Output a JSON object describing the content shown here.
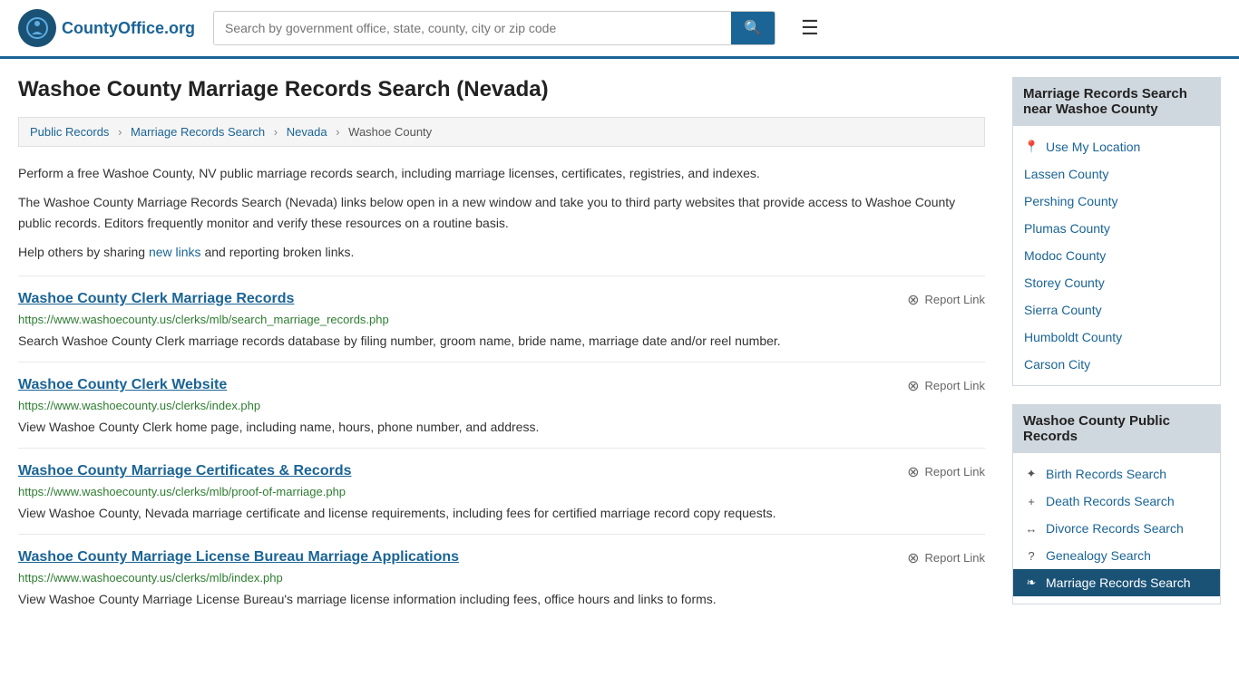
{
  "header": {
    "logo_text": "County",
    "logo_suffix": "Office.org",
    "search_placeholder": "Search by government office, state, county, city or zip code",
    "menu_icon": "☰"
  },
  "page": {
    "title": "Washoe County Marriage Records Search (Nevada)"
  },
  "breadcrumb": {
    "items": [
      "Public Records",
      "Marriage Records Search",
      "Nevada",
      "Washoe County"
    ]
  },
  "description": {
    "para1": "Perform a free Washoe County, NV public marriage records search, including marriage licenses, certificates, registries, and indexes.",
    "para2": "The Washoe County Marriage Records Search (Nevada) links below open in a new window and take you to third party websites that provide access to Washoe County public records. Editors frequently monitor and verify these resources on a routine basis.",
    "para3_prefix": "Help others by sharing ",
    "para3_link": "new links",
    "para3_suffix": " and reporting broken links."
  },
  "records": [
    {
      "title": "Washoe County Clerk Marriage Records",
      "url": "https://www.washoecounty.us/clerks/mlb/search_marriage_records.php",
      "desc": "Search Washoe County Clerk marriage records database by filing number, groom name, bride name, marriage date and/or reel number.",
      "report": "Report Link"
    },
    {
      "title": "Washoe County Clerk Website",
      "url": "https://www.washoecounty.us/clerks/index.php",
      "desc": "View Washoe County Clerk home page, including name, hours, phone number, and address.",
      "report": "Report Link"
    },
    {
      "title": "Washoe County Marriage Certificates & Records",
      "url": "https://www.washoecounty.us/clerks/mlb/proof-of-marriage.php",
      "desc": "View Washoe County, Nevada marriage certificate and license requirements, including fees for certified marriage record copy requests.",
      "report": "Report Link"
    },
    {
      "title": "Washoe County Marriage License Bureau Marriage Applications",
      "url": "https://www.washoecounty.us/clerks/mlb/index.php",
      "desc": "View Washoe County Marriage License Bureau's marriage license information including fees, office hours and links to forms.",
      "report": "Report Link"
    }
  ],
  "sidebar_nearby": {
    "header": "Marriage Records Search near Washoe County",
    "use_location": "Use My Location",
    "items": [
      "Lassen County",
      "Pershing County",
      "Plumas County",
      "Modoc County",
      "Storey County",
      "Sierra County",
      "Humboldt County",
      "Carson City"
    ]
  },
  "sidebar_public_records": {
    "header": "Washoe County Public Records",
    "items": [
      {
        "label": "Birth Records Search",
        "icon": "✦",
        "active": false
      },
      {
        "label": "Death Records Search",
        "icon": "+",
        "active": false
      },
      {
        "label": "Divorce Records Search",
        "icon": "↔",
        "active": false
      },
      {
        "label": "Genealogy Search",
        "icon": "?",
        "active": false
      },
      {
        "label": "Marriage Records Search",
        "icon": "❧",
        "active": true
      }
    ]
  }
}
